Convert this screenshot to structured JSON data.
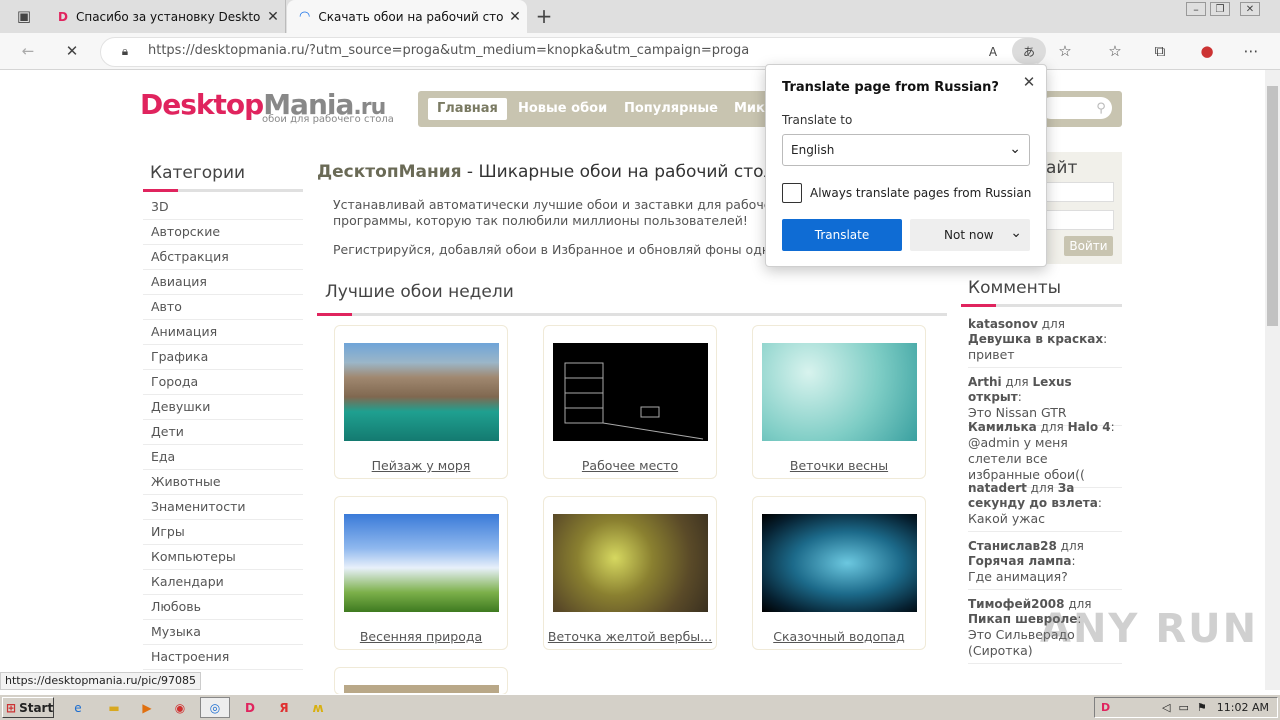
{
  "browser": {
    "tabs": [
      {
        "favicon": "D",
        "title": "Спасибо за установку DesktopM"
      },
      {
        "title": "Скачать обои на рабочий стол"
      }
    ],
    "url": "https://desktopmania.ru/?utm_source=proga&utm_medium=knopka&utm_campaign=proga",
    "status_url": "https://desktopmania.ru/pic/97085"
  },
  "site": {
    "logo_a": "Desktop",
    "logo_b": "Mania",
    "logo_c": ".ru",
    "logo_sub": "обои для рабочего стола",
    "nav": [
      "Главная",
      "Новые обои",
      "Популярные",
      "Мико"
    ],
    "categories_title": "Категории",
    "categories": [
      "3D",
      "Авторские",
      "Абстракция",
      "Авиация",
      "Авто",
      "Анимация",
      "Графика",
      "Города",
      "Девушки",
      "Дети",
      "Еда",
      "Животные",
      "Знаменитости",
      "Игры",
      "Компьютеры",
      "Календари",
      "Любовь",
      "Музыка",
      "Настроения"
    ],
    "heading_bold": "ДесктопМания",
    "heading_rest": " - Шикарные обои на рабочий стол в",
    "para1a": "Устанавливай автоматически лучшие обои и заставки для рабочего",
    "para1b": "программы, которую так полюбили миллионы пользователей!",
    "para2": "Регистрируйся, добавляй обои в Избранное и обновляй фоны одним кли",
    "best_title": "Лучшие обои недели",
    "wallpapers": [
      "Пейзаж у моря",
      "Рабочее место",
      "Веточки весны",
      "Весенняя природа",
      "Веточка желтой вербы...",
      "Сказочный водопад"
    ],
    "login_title": "айт",
    "login_button": "Войти",
    "comments_title": "Комменты",
    "comments": [
      {
        "user": "katasonov",
        "for": " для ",
        "target": "Девушка в красках",
        "text": "привет"
      },
      {
        "user": "Arthi",
        "for": " для ",
        "target": "Lexus открыт",
        "text": "Это Nissan GTR"
      },
      {
        "user": "Камилька",
        "for": " для ",
        "target": "Halo 4",
        "text": "@admin у меня слетели все избранные обои(("
      },
      {
        "user": "natadert",
        "for": " для ",
        "target": "За секунду до взлета",
        "text": "Какой ужас"
      },
      {
        "user": "Станислав28",
        "for": " для ",
        "target": "Горячая лампа",
        "text": "Где анимация?"
      },
      {
        "user": "Тимофей2008",
        "for": " для ",
        "target": "Пикап шевроле",
        "text": "Это Сильверадо (Сиротка)"
      }
    ]
  },
  "translate": {
    "title": "Translate page from Russian?",
    "label": "Translate to",
    "language": "English",
    "checkbox": "Always translate pages from Russian",
    "translate_btn": "Translate",
    "notnow_btn": "Not now"
  },
  "taskbar": {
    "start": "Start",
    "clock": "11:02 AM"
  },
  "watermark": "ANY RUN",
  "colors": {
    "brand": "#e0245e",
    "nav": "#c8c4b0",
    "accent_blue": "#0f6cd4"
  }
}
